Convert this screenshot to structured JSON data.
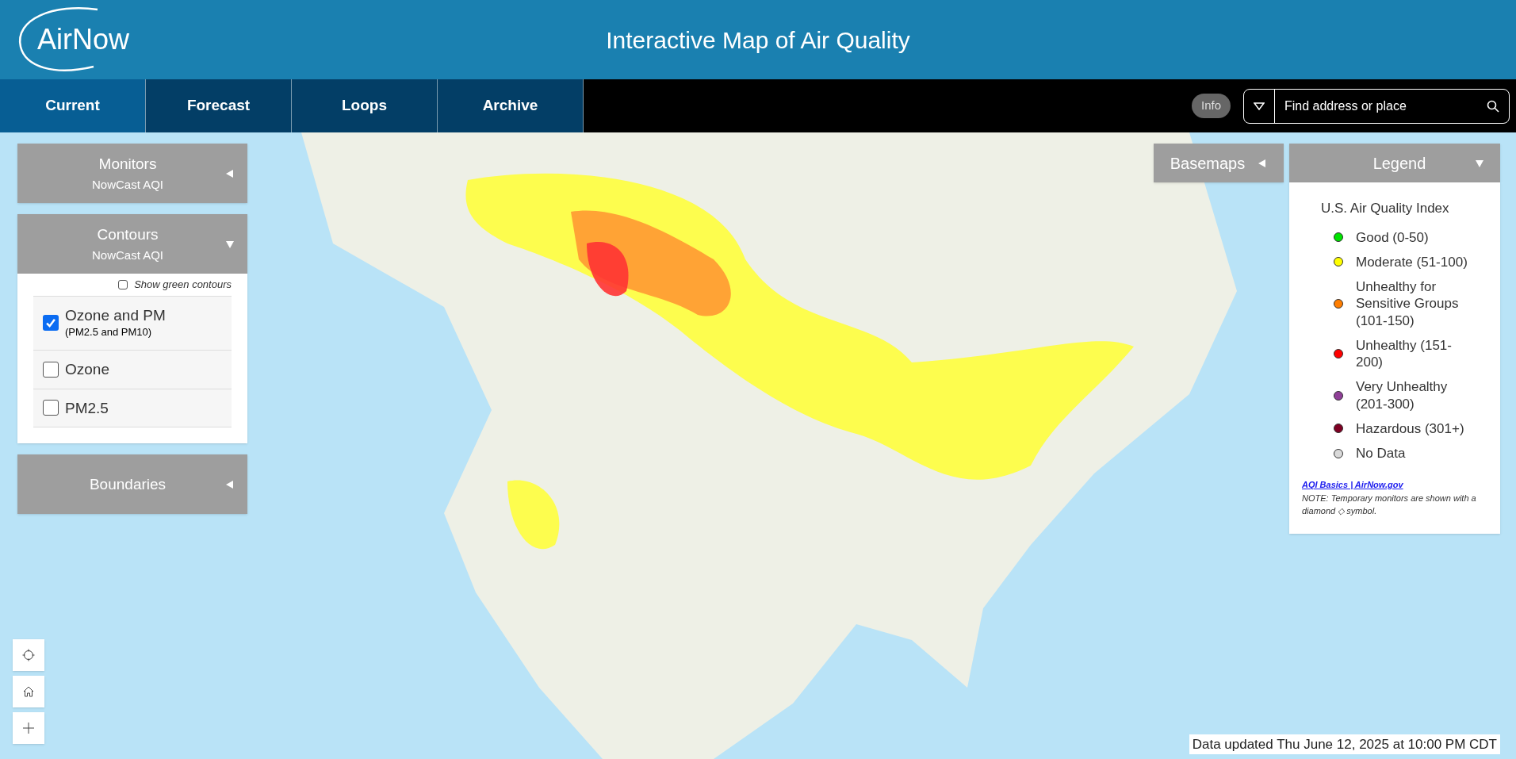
{
  "header": {
    "logo": "AirNow",
    "title": "Interactive Map of Air Quality"
  },
  "tabs": [
    {
      "label": "Current",
      "selected": true
    },
    {
      "label": "Forecast",
      "selected": false
    },
    {
      "label": "Loops",
      "selected": false
    },
    {
      "label": "Archive",
      "selected": false
    }
  ],
  "info_button": "Info",
  "search": {
    "placeholder": "Find address or place"
  },
  "left_panels": [
    {
      "title": "Monitors",
      "subtitle": "NowCast AQI",
      "expanded": false
    },
    {
      "title": "Contours",
      "subtitle": "NowCast AQI",
      "expanded": true,
      "toggle": {
        "label": "Show green contours",
        "checked": false
      },
      "options": [
        {
          "label": "Ozone and PM",
          "sublabel": "(PM2.5 and PM10)",
          "checked": true
        },
        {
          "label": "Ozone",
          "checked": false
        },
        {
          "label": "PM2.5",
          "checked": false
        }
      ]
    },
    {
      "title": "Boundaries",
      "expanded": false
    }
  ],
  "basemaps": {
    "title": "Basemaps",
    "expanded": false
  },
  "legend": {
    "title": "Legend",
    "expanded": true,
    "heading": "U.S. Air Quality Index",
    "items": [
      {
        "label": "Good (0-50)",
        "color": "#00e400"
      },
      {
        "label": "Moderate (51-100)",
        "color": "#ffff00"
      },
      {
        "label": "Unhealthy for Sensitive Groups (101-150)",
        "color": "#ff7e00"
      },
      {
        "label": "Unhealthy (151-200)",
        "color": "#ff0000"
      },
      {
        "label": "Very Unhealthy (201-300)",
        "color": "#8f3f97"
      },
      {
        "label": "Hazardous (301+)",
        "color": "#7e0023"
      },
      {
        "label": "No Data",
        "color": "#d9d9d9"
      }
    ],
    "link": "AQI Basics | AirNow.gov",
    "note": "NOTE: Temporary monitors are shown with a diamond ◇ symbol."
  },
  "map_controls": [
    {
      "kind": "locate"
    },
    {
      "kind": "home"
    },
    {
      "kind": "zoom-in"
    }
  ],
  "status": "Data updated Thu June 12, 2025 at 10:00 PM CDT"
}
